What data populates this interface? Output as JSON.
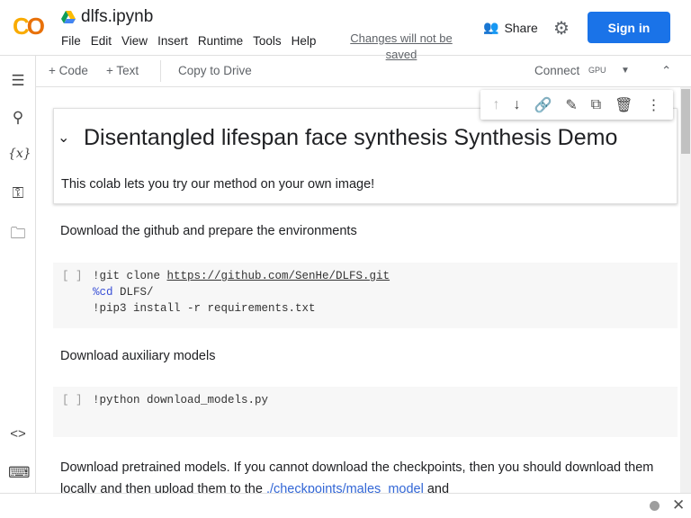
{
  "header": {
    "logo": "CO",
    "filename": "dlfs.ipynb",
    "menu": [
      "File",
      "Edit",
      "View",
      "Insert",
      "Runtime",
      "Tools",
      "Help"
    ],
    "changes": "Changes will not be saved",
    "share": "Share",
    "signin": "Sign in"
  },
  "toolbar": {
    "code": "+ Code",
    "text": "+ Text",
    "copy": "Copy to Drive",
    "connect": "Connect",
    "gpu": "GPU"
  },
  "cells": {
    "title": "Disentangled lifespan face synthesis Synthesis Demo",
    "intro": "This colab lets you try our method on your own image!",
    "t1": "Download the github and prepare the environments",
    "c1_bracket": "[ ]",
    "c1_l1a": "!git clone ",
    "c1_l1b": "https://github.com/SenHe/DLFS.git",
    "c1_l2a": "%cd",
    "c1_l2b": " DLFS/",
    "c1_l3": "!pip3 install -r requirements.txt",
    "t2": "Download auxiliary models",
    "c2_bracket": "[ ]",
    "c2_l1": "!python download_models.py",
    "t3a": "Download pretrained models. If you cannot download the checkpoints, then you should download them locally and then upload them to the ",
    "t3link": "./checkpoints/males_model",
    "t3b": " and"
  },
  "colors": {
    "accent": "#1a73e8",
    "logo_orange": "#e8710a",
    "logo_yellow": "#f9ab00"
  }
}
